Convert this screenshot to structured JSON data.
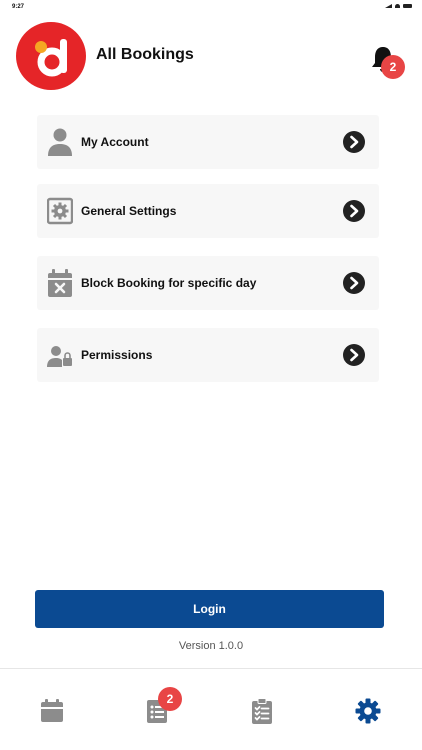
{
  "status_bar": {
    "time": "9:27"
  },
  "header": {
    "title": "All Bookings",
    "notification_count": "2"
  },
  "menu": {
    "items": [
      {
        "label": "My Account",
        "icon": "user-icon"
      },
      {
        "label": "General Settings",
        "icon": "settings-box-icon"
      },
      {
        "label": "Block Booking for specific day",
        "icon": "calendar-block-icon"
      },
      {
        "label": "Permissions",
        "icon": "user-lock-icon"
      }
    ]
  },
  "login_button": {
    "label": "Login"
  },
  "version_text": "Version 1.0.0",
  "tabbar": {
    "tabs": [
      {
        "icon": "calendar-icon",
        "active": false
      },
      {
        "icon": "list-icon",
        "active": false,
        "badge": "2"
      },
      {
        "icon": "clipboard-checklist-icon",
        "active": false
      },
      {
        "icon": "gear-icon",
        "active": true
      }
    ]
  },
  "colors": {
    "brand_red": "#e52528",
    "primary_blue": "#0b4a92",
    "badge_red": "#e84545",
    "icon_gray": "#8c8c8c",
    "active_tab": "#0b4a92"
  }
}
